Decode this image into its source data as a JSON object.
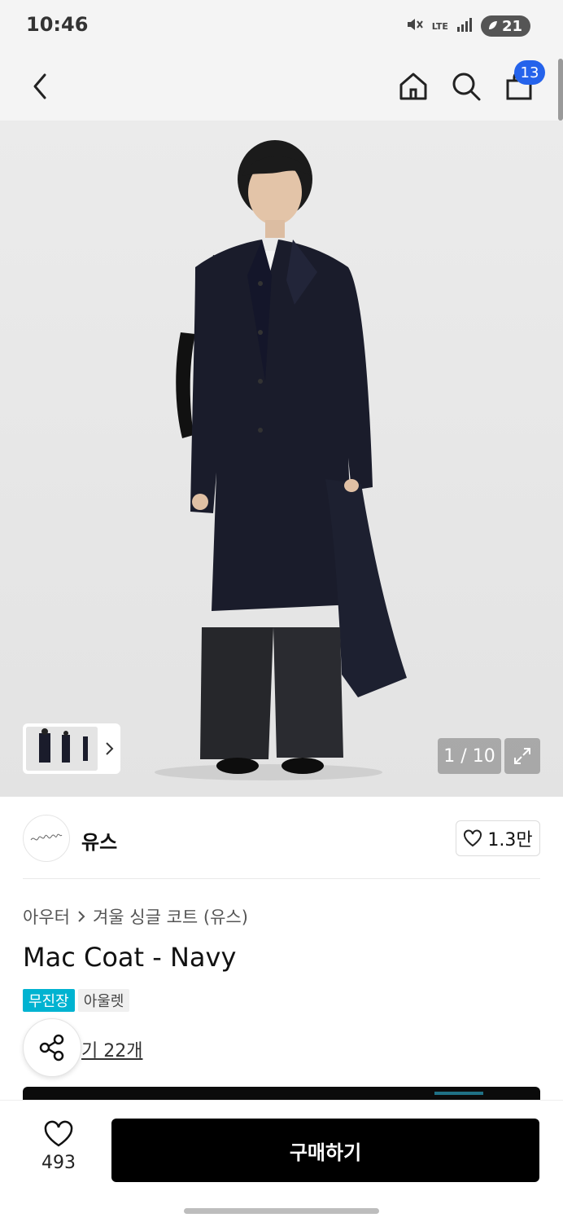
{
  "status_bar": {
    "time": "10:46",
    "network": "LTE",
    "battery": "21"
  },
  "nav": {
    "cart_count": "13"
  },
  "gallery": {
    "page_indicator": "1 / 10"
  },
  "brand": {
    "name": "유스",
    "likes": "1.3만"
  },
  "product": {
    "breadcrumb": [
      "아우터",
      "겨울 싱글 코트 (유스)"
    ],
    "title": "Mac Coat - Navy",
    "tags": [
      "무진장",
      "아울렛"
    ],
    "review_text": "기 22개"
  },
  "bottom_bar": {
    "wish_count": "493",
    "buy_label": "구매하기"
  },
  "colors": {
    "accent": "#00b3d1",
    "badge": "#2563eb",
    "coat": "#1a1c2b"
  }
}
